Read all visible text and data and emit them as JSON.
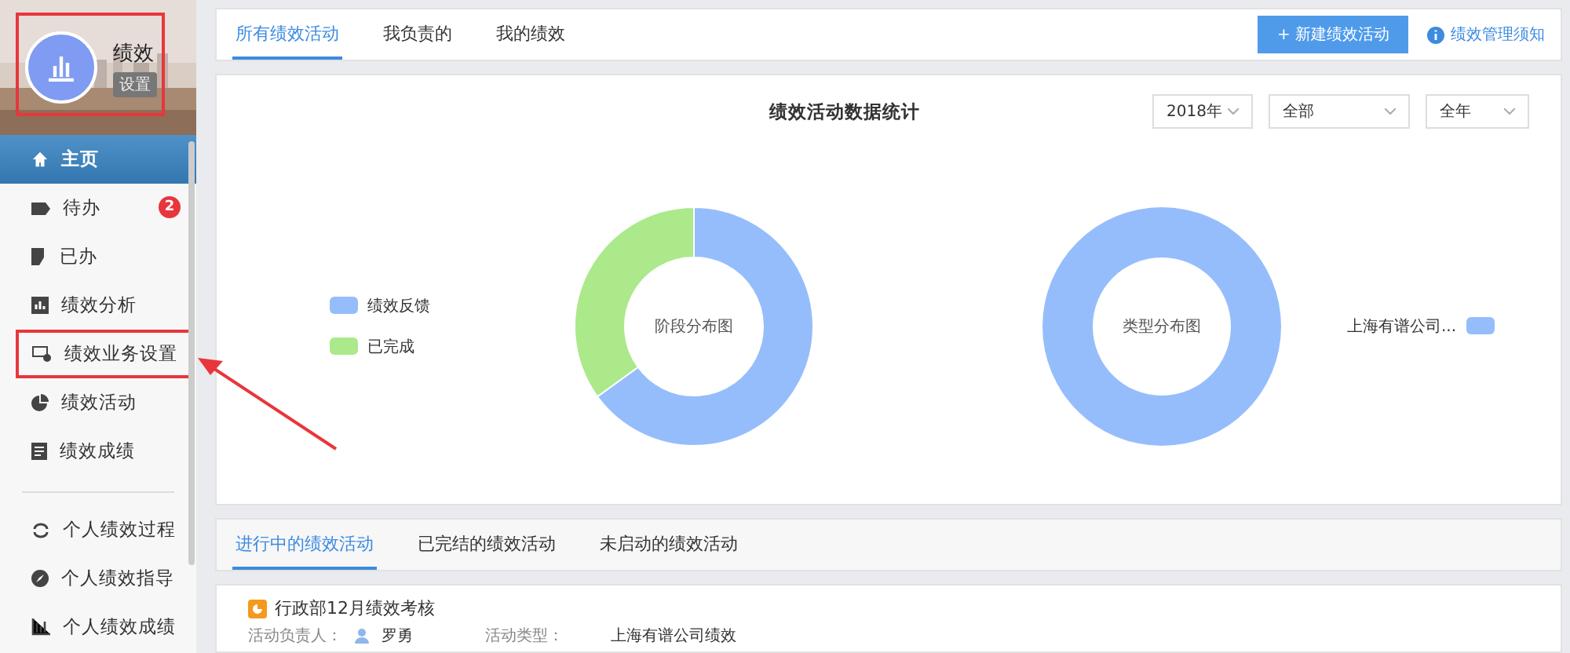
{
  "profile": {
    "name": "绩效",
    "tag": "设置"
  },
  "menu": [
    {
      "label": "主页",
      "selected": true,
      "annotated": false
    },
    {
      "label": "待办",
      "selected": false,
      "annotated": false,
      "badge": "2"
    },
    {
      "label": "已办",
      "selected": false,
      "annotated": false
    },
    {
      "label": "绩效分析",
      "selected": false,
      "annotated": false
    },
    {
      "label": "绩效业务设置",
      "selected": false,
      "annotated": true
    },
    {
      "label": "绩效活动",
      "selected": false,
      "annotated": false
    },
    {
      "label": "绩效成绩",
      "selected": false,
      "annotated": false
    }
  ],
  "personal_menu": [
    {
      "label": "个人绩效过程",
      "selected": false,
      "annotated": false
    },
    {
      "label": "个人绩效指导",
      "selected": false,
      "annotated": false
    },
    {
      "label": "个人绩效成绩",
      "selected": false,
      "annotated": false
    }
  ],
  "top_tabs": [
    {
      "label": "所有绩效活动",
      "selected": true
    },
    {
      "label": "我负责的",
      "selected": false
    },
    {
      "label": "我的绩效",
      "selected": false
    }
  ],
  "new_button": "+ 新建绩效活动",
  "help_link": "绩效管理须知",
  "stats": {
    "title": "绩效活动数据统计",
    "filters": [
      "2018年",
      "全部",
      "全年"
    ],
    "stage_chart": {
      "center": "阶段分布图",
      "legend": [
        {
          "label": "绩效反馈",
          "color": "#96bdfb"
        },
        {
          "label": "已完成",
          "color": "#abe98a"
        }
      ]
    },
    "type_chart": {
      "center": "类型分布图",
      "legend": [
        {
          "label": "上海有谱公司...",
          "color": "#96bdfb"
        }
      ]
    }
  },
  "activity_tabs": [
    {
      "label": "进行中的绩效活动",
      "selected": true
    },
    {
      "label": "已完结的绩效活动",
      "selected": false
    },
    {
      "label": "未启动的绩效活动",
      "selected": false
    }
  ],
  "activity": {
    "title": "行政部12月绩效考核",
    "owner_label": "活动负责人：",
    "owner": "罗勇",
    "type_label": "活动类型：",
    "type": "上海有谱公司绩效"
  }
}
